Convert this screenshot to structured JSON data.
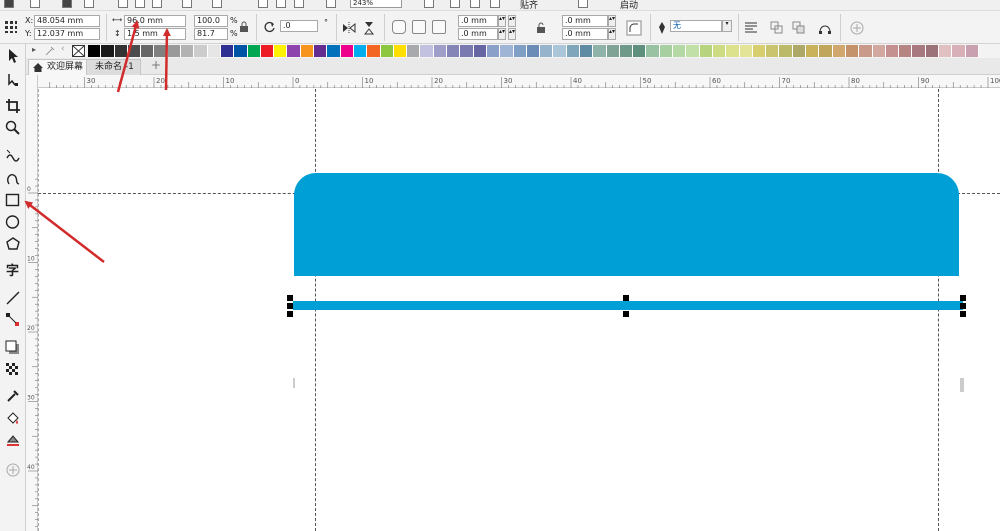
{
  "top_toolbar": {
    "zoom_value": "243%",
    "snap_label": "贴齐",
    "launch_label": "启动"
  },
  "property_bar": {
    "x_label": "X:",
    "x_value": "48.054 mm",
    "y_label": "Y:",
    "y_value": "12.037 mm",
    "width_value": "96.0 mm",
    "height_value": "1.5 mm",
    "scale_x": "100.0",
    "scale_y": "81.7",
    "percent_sign": "%",
    "rotation_value": ".0",
    "rotation_unit": "°",
    "corner_tl": ".0 mm",
    "corner_bl": ".0 mm",
    "corner_tr": ".0 mm",
    "corner_br": ".0 mm",
    "outline_value": "无"
  },
  "palette": {
    "colors": [
      "#000000",
      "#1a1a1a",
      "#333333",
      "#4d4d4d",
      "#666666",
      "#808080",
      "#999999",
      "#b3b3b3",
      "#cccccc",
      "#e6e6e6",
      "#2e3192",
      "#0054a6",
      "#00a651",
      "#ed1c24",
      "#fff200",
      "#8e44ad",
      "#f7941d",
      "#662d91",
      "#0072bc",
      "#ec008c",
      "#00aeef",
      "#f26522",
      "#8dc63f",
      "#ffde00",
      "#a7a9ac",
      "#c2c2e0",
      "#9e9ec9",
      "#8585b8",
      "#7a7ab0",
      "#6666a3",
      "#8aa0c8",
      "#9fb5d6",
      "#7f9fc4",
      "#6c8cb8",
      "#96b4cc",
      "#aac6d8",
      "#7fa6bb",
      "#5f8ca3",
      "#8fb3a8",
      "#7fa394",
      "#6f9a8a",
      "#5f8f7d",
      "#99c2a2",
      "#a8cfa0",
      "#b5d9a4",
      "#c1e0a8",
      "#b8d37e",
      "#cddc82",
      "#dce28b",
      "#e4e498",
      "#d7cf6f",
      "#c9c46d",
      "#bbb96a",
      "#ada867",
      "#c9b25a",
      "#bfa65a",
      "#d1a770",
      "#c4936b",
      "#c99a8a",
      "#d2a8a0",
      "#c49090",
      "#b78484",
      "#a87a80",
      "#9d737a",
      "#e0c0c0",
      "#d8b0b8",
      "#c8a0b0"
    ]
  },
  "tabs": [
    {
      "label": "欢迎屏幕"
    },
    {
      "label": "未命名 -1"
    }
  ],
  "tab_add_label": "+",
  "ruler": {
    "h_labels": [
      "30",
      "20",
      "10",
      "0",
      "10",
      "20",
      "30",
      "40",
      "50",
      "60",
      "70",
      "80",
      "90",
      "100"
    ],
    "v_labels": [
      "0",
      "10",
      "20",
      "30",
      "40",
      "50"
    ]
  },
  "canvas": {
    "shape_color": "#00a0d6",
    "guide_color": "#555555"
  },
  "annotation_color": "#d22b2b"
}
